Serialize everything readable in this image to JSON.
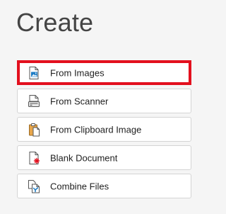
{
  "page": {
    "title": "Create"
  },
  "options": [
    {
      "label": "From Images",
      "icon": "image-file-icon",
      "selected": true
    },
    {
      "label": "From Scanner",
      "icon": "scanner-icon",
      "selected": false
    },
    {
      "label": "From Clipboard Image",
      "icon": "clipboard-icon",
      "selected": false
    },
    {
      "label": "Blank Document",
      "icon": "blank-document-icon",
      "selected": false
    },
    {
      "label": "Combine Files",
      "icon": "combine-files-icon",
      "selected": false
    }
  ],
  "colors": {
    "selection_border": "#e3101e",
    "accent_blue": "#1c7bc4",
    "accent_red": "#e3101e",
    "clipboard_orange": "#e8a64a"
  }
}
